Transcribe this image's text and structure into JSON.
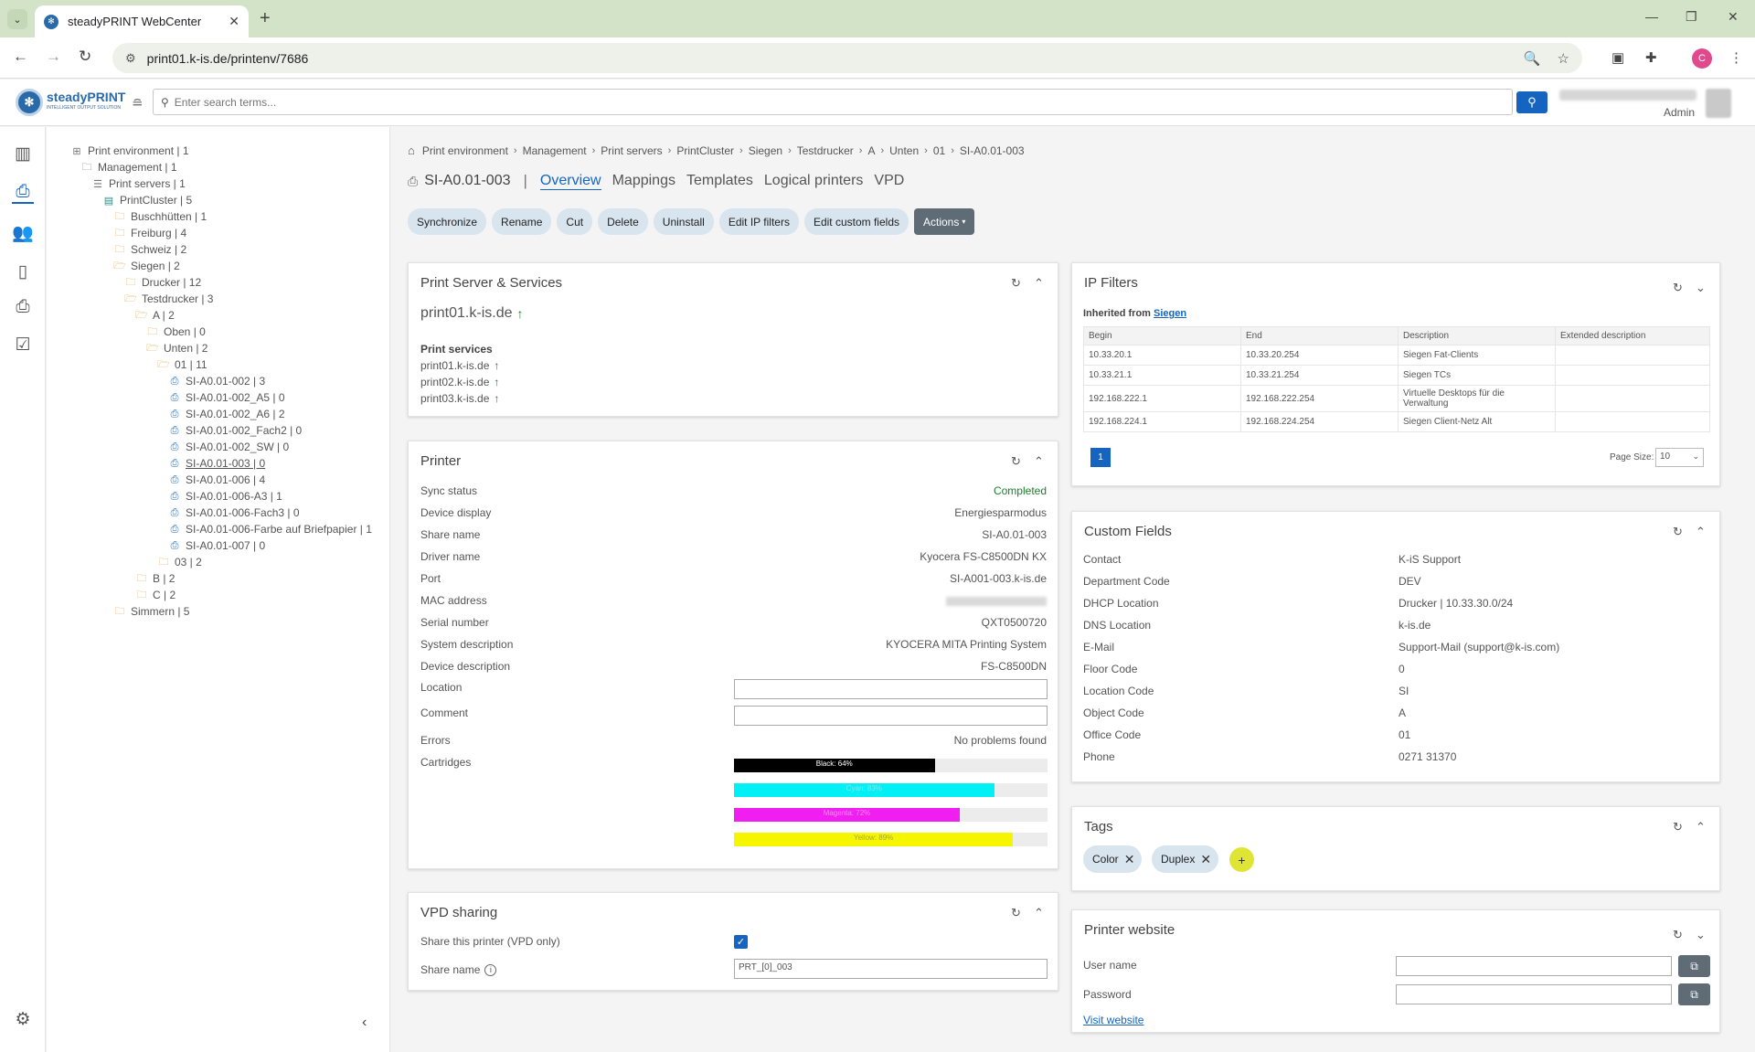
{
  "browser": {
    "tab_title": "steadyPRINT WebCenter",
    "url": "print01.k-is.de/printenv/7686",
    "profile_initial": "C"
  },
  "header": {
    "logo_text": "steadyPRINT",
    "logo_sub": "INTELLIGENT OUTPUT SOLUTION",
    "search_placeholder": "Enter search terms...",
    "user_role": "Admin"
  },
  "tree": [
    {
      "label": "Print environment | 1",
      "icon": "grid-icon"
    },
    {
      "label": "Management | 1",
      "icon": "management-icon"
    },
    {
      "label": "Print servers | 1",
      "icon": "list-icon"
    },
    {
      "label": "PrintCluster | 5",
      "icon": "cluster-icon"
    },
    {
      "label": "Buschhütten | 1",
      "icon": "folder-icon"
    },
    {
      "label": "Freiburg | 4",
      "icon": "folder-icon"
    },
    {
      "label": "Schweiz | 2",
      "icon": "folder-icon"
    },
    {
      "label": "Siegen | 2",
      "icon": "folder-open-icon"
    },
    {
      "label": "Drucker | 12",
      "icon": "folder-icon"
    },
    {
      "label": "Testdrucker | 3",
      "icon": "folder-open-icon"
    },
    {
      "label": "A | 2",
      "icon": "folder-open-icon"
    },
    {
      "label": "Oben | 0",
      "icon": "folder-icon"
    },
    {
      "label": "Unten | 2",
      "icon": "folder-open-icon"
    },
    {
      "label": "01 | 11",
      "icon": "folder-open-icon"
    },
    {
      "label": "SI-A0.01-002 | 3",
      "icon": "printer-icon"
    },
    {
      "label": "SI-A0.01-002_A5 | 0",
      "icon": "printer-icon"
    },
    {
      "label": "SI-A0.01-002_A6 | 2",
      "icon": "printer-icon"
    },
    {
      "label": "SI-A0.01-002_Fach2 | 0",
      "icon": "printer-icon"
    },
    {
      "label": "SI-A0.01-002_SW | 0",
      "icon": "printer-icon"
    },
    {
      "label": "SI-A0.01-003 | 0",
      "icon": "printer-icon"
    },
    {
      "label": "SI-A0.01-006 | 4",
      "icon": "printer-icon"
    },
    {
      "label": "SI-A0.01-006-A3 | 1",
      "icon": "printer-icon"
    },
    {
      "label": "SI-A0.01-006-Fach3 | 0",
      "icon": "printer-icon"
    },
    {
      "label": "SI-A0.01-006-Farbe auf Briefpapier | 1",
      "icon": "printer-icon"
    },
    {
      "label": "SI-A0.01-007 | 0",
      "icon": "printer-icon"
    },
    {
      "label": "03 | 2",
      "icon": "folder-icon"
    },
    {
      "label": "B | 2",
      "icon": "folder-icon"
    },
    {
      "label": "C | 2",
      "icon": "folder-icon"
    },
    {
      "label": "Simmern | 5",
      "icon": "folder-icon"
    }
  ],
  "breadcrumb": [
    "Print environment",
    "Management",
    "Print servers",
    "PrintCluster",
    "Siegen",
    "Testdrucker",
    "A",
    "Unten",
    "01",
    "SI-A0.01-003"
  ],
  "page": {
    "title": "SI-A0.01-003",
    "tabs": [
      "Overview",
      "Mappings",
      "Templates",
      "Logical printers",
      "VPD"
    ],
    "active_tab": "Overview"
  },
  "actions": [
    "Synchronize",
    "Rename",
    "Cut",
    "Delete",
    "Uninstall",
    "Edit IP filters",
    "Edit custom fields",
    "Actions"
  ],
  "print_server": {
    "title": "Print Server & Services",
    "server": "print01.k-is.de",
    "services_label": "Print services",
    "services": [
      "print01.k-is.de",
      "print02.k-is.de",
      "print03.k-is.de"
    ]
  },
  "printer": {
    "title": "Printer",
    "rows": [
      {
        "label": "Sync status",
        "value": "Completed"
      },
      {
        "label": "Device display",
        "value": "Energiesparmodus"
      },
      {
        "label": "Share name",
        "value": "SI-A0.01-003"
      },
      {
        "label": "Driver name",
        "value": "Kyocera FS-C8500DN KX"
      },
      {
        "label": "Port",
        "value": "SI-A001-003.k-is.de"
      },
      {
        "label": "MAC address",
        "value": ""
      },
      {
        "label": "Serial number",
        "value": "QXT0500720"
      },
      {
        "label": "System description",
        "value": "KYOCERA MITA Printing System"
      },
      {
        "label": "Device description",
        "value": "FS-C8500DN"
      }
    ],
    "location_label": "Location",
    "comment_label": "Comment",
    "errors_label": "Errors",
    "errors_value": "No problems found",
    "cartridges_label": "Cartridges",
    "cartridges": [
      {
        "name": "Black",
        "label": "Black: 64%",
        "level": 0.64,
        "color": "#000000",
        "text_color": "#ffffff"
      },
      {
        "name": "Cyan",
        "label": "Cyan: 83%",
        "level": 0.83,
        "color": "#00f0f5",
        "text_color": "#7fe9ed"
      },
      {
        "name": "Magenta",
        "label": "Magenta: 72%",
        "level": 0.72,
        "color": "#f01ef0",
        "text_color": "#f58ef5"
      },
      {
        "name": "Yellow",
        "label": "Yellow: 89%",
        "level": 0.89,
        "color": "#f5f500",
        "text_color": "#a8a840"
      }
    ]
  },
  "vpd": {
    "title": "VPD sharing",
    "share_label": "Share this printer (VPD only)",
    "share_name_label": "Share name",
    "share_name_value": "PRT_[0]_003"
  },
  "ip_filters": {
    "title": "IP Filters",
    "inherited_label": "Inherited from",
    "inherited_link": "Siegen",
    "columns": [
      "Begin",
      "End",
      "Description",
      "Extended description"
    ],
    "rows": [
      [
        "10.33.20.1",
        "10.33.20.254",
        "Siegen Fat-Clients",
        ""
      ],
      [
        "10.33.21.1",
        "10.33.21.254",
        "Siegen TCs",
        ""
      ],
      [
        "192.168.222.1",
        "192.168.222.254",
        "Virtuelle Desktops für die Verwaltung",
        ""
      ],
      [
        "192.168.224.1",
        "192.168.224.254",
        "Siegen Client-Netz Alt",
        ""
      ]
    ],
    "page": "1",
    "page_size_label": "Page Size:",
    "page_size": "10"
  },
  "custom_fields": {
    "title": "Custom Fields",
    "rows": [
      {
        "label": "Contact",
        "value": "K-iS Support"
      },
      {
        "label": "Department Code",
        "value": "DEV"
      },
      {
        "label": "DHCP Location",
        "value": "Drucker | 10.33.30.0/24"
      },
      {
        "label": "DNS Location",
        "value": "k-is.de"
      },
      {
        "label": "E-Mail",
        "value": "Support-Mail (support@k-is.com)"
      },
      {
        "label": "Floor Code",
        "value": "0"
      },
      {
        "label": "Location Code",
        "value": "SI"
      },
      {
        "label": "Object Code",
        "value": "A"
      },
      {
        "label": "Office Code",
        "value": "01"
      },
      {
        "label": "Phone",
        "value": "0271 31370"
      }
    ]
  },
  "tags": {
    "title": "Tags",
    "items": [
      "Color",
      "Duplex"
    ]
  },
  "website": {
    "title": "Printer website",
    "user_label": "User name",
    "password_label": "Password",
    "visit_label": "Visit website"
  }
}
